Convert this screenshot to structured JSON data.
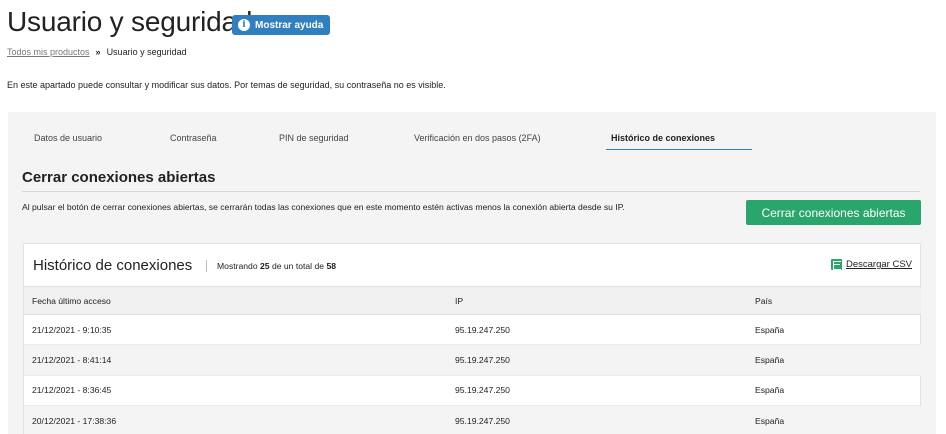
{
  "page": {
    "title": "Usuario y seguridad",
    "help_label": "Mostrar ayuda",
    "breadcrumb": {
      "root": "Todos mis productos",
      "separator": "»",
      "current": "Usuario y seguridad"
    },
    "intro": "En este apartado puede consultar y modificar sus datos. Por temas de seguridad, su contraseña no es visible."
  },
  "tabs": [
    {
      "label": "Datos de usuario",
      "active": false
    },
    {
      "label": "Contraseña",
      "active": false
    },
    {
      "label": "PIN de seguridad",
      "active": false
    },
    {
      "label": "Verificación en dos pasos (2FA)",
      "active": false
    },
    {
      "label": "Histórico de conexiones",
      "active": true
    }
  ],
  "close_section": {
    "title": "Cerrar conexiones abiertas",
    "description": "Al pulsar el botón de cerrar conexiones abiertas, se cerrarán todas las conexiones que en este momento estén activas menos la conexión abierta desde su IP.",
    "button_label": "Cerrar conexiones abiertas"
  },
  "history": {
    "title": "Histórico de conexiones",
    "count_prefix": "Mostrando",
    "shown": "25",
    "count_middle": "de un total de",
    "total": "58",
    "download_label": "Descargar CSV",
    "columns": [
      "Fecha último acceso",
      "IP",
      "País"
    ],
    "rows": [
      [
        "21/12/2021 - 9:10:35",
        "95.19.247.250",
        "España"
      ],
      [
        "21/12/2021 - 8:41:14",
        "95.19.247.250",
        "España"
      ],
      [
        "21/12/2021 - 8:36:45",
        "95.19.247.250",
        "España"
      ],
      [
        "20/12/2021 - 17:38:36",
        "95.19.247.250",
        "España"
      ]
    ]
  },
  "colors": {
    "primary": "#2f7fc1",
    "success": "#2aa56c",
    "panel_bg": "#f4f4f4"
  }
}
